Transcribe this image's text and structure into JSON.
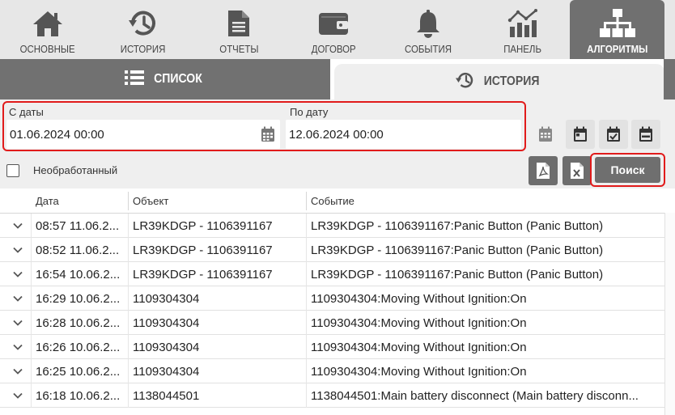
{
  "nav": {
    "items": [
      {
        "label": "ОСНОВНЫЕ",
        "icon": "home-icon"
      },
      {
        "label": "ИСТОРИЯ",
        "icon": "history-icon"
      },
      {
        "label": "ОТЧЕТЫ",
        "icon": "document-icon"
      },
      {
        "label": "ДОГОВОР",
        "icon": "wallet-icon"
      },
      {
        "label": "СОБЫТИЯ",
        "icon": "bell-icon"
      },
      {
        "label": "ПАНЕЛЬ",
        "icon": "chart-icon"
      },
      {
        "label": "АЛГОРИТМЫ",
        "icon": "hierarchy-icon",
        "active": true
      }
    ]
  },
  "subtabs": {
    "list_label": "СПИСОК",
    "history_label": "ИСТОРИЯ"
  },
  "filters": {
    "from_label": "С даты",
    "from_value": "01.06.2024 00:00",
    "to_label": "По дату",
    "to_value": "12.06.2024 00:00",
    "unprocessed_label": "Необработанный",
    "search_label": "Поиск"
  },
  "table": {
    "columns": [
      "Дата",
      "Объект",
      "Событие"
    ],
    "rows": [
      {
        "date": "08:57 11.06.2...",
        "object": "LR39KDGP - 1106391167",
        "event": "LR39KDGP - 1106391167:Panic Button (Panic Button)"
      },
      {
        "date": "08:52 11.06.2...",
        "object": "LR39KDGP - 1106391167",
        "event": "LR39KDGP - 1106391167:Panic Button (Panic Button)"
      },
      {
        "date": "16:54 10.06.2...",
        "object": "LR39KDGP - 1106391167",
        "event": "LR39KDGP - 1106391167:Panic Button (Panic Button)"
      },
      {
        "date": "16:29 10.06.2...",
        "object": "1109304304",
        "event": "1109304304:Moving Without Ignition:On"
      },
      {
        "date": "16:28 10.06.2...",
        "object": "1109304304",
        "event": "1109304304:Moving Without Ignition:On"
      },
      {
        "date": "16:26 10.06.2...",
        "object": "1109304304",
        "event": "1109304304:Moving Without Ignition:On"
      },
      {
        "date": "16:25 10.06.2...",
        "object": "1109304304",
        "event": "1109304304:Moving Without Ignition:On"
      },
      {
        "date": "16:18 10.06.2...",
        "object": "1138044501",
        "event": "1138044501:Main battery disconnect (Main battery disconn..."
      }
    ]
  },
  "colors": {
    "accent_red": "#e11b1b",
    "active_tab": "#707070",
    "nav_bg": "#e7e7e7"
  }
}
